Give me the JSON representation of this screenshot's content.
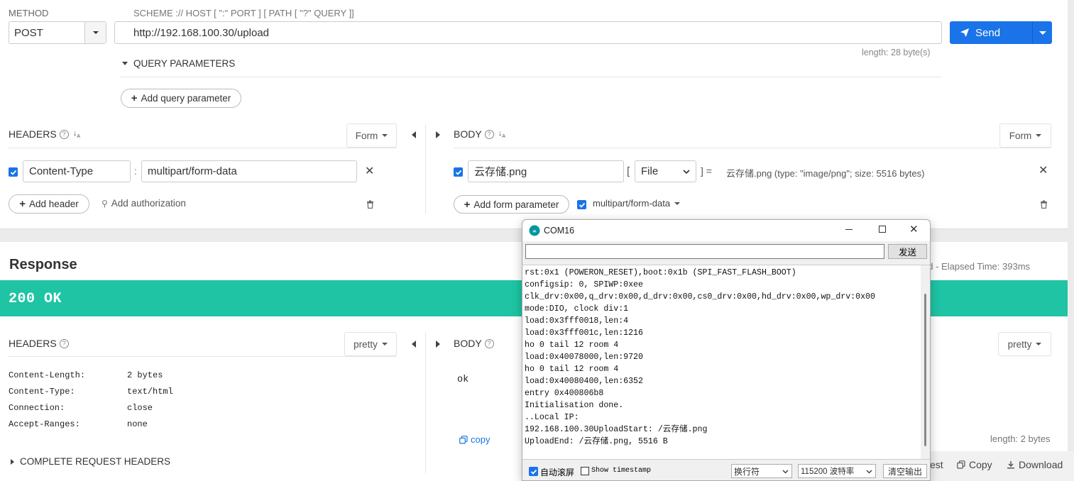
{
  "request": {
    "method_label": "METHOD",
    "method_value": "POST",
    "url_hint": "SCHEME :// HOST [ \":\" PORT ] [ PATH [ \"?\" QUERY ]]",
    "url_value": "http://192.168.100.30/upload",
    "send_label": "Send",
    "length_text": "length: 28 byte(s)",
    "query_params_label": "QUERY PARAMETERS",
    "add_query_param_label": "Add query parameter",
    "headers_label": "HEADERS",
    "headers_mode": "Form",
    "header_name": "Content-Type",
    "header_sep": ":",
    "header_value": "multipart/form-data",
    "add_header_label": "Add header",
    "add_auth_label": "Add authorization",
    "body_label": "BODY",
    "body_mode": "Form",
    "form_name": "云存储.png",
    "form_bracket_open": "[",
    "form_type": "File",
    "form_bracket_close": "] =",
    "form_file_desc": "云存储.png (type: \"image/png\"; size: 5516 bytes)",
    "add_form_param_label": "Add form parameter",
    "multipart_label": "multipart/form-data"
  },
  "response": {
    "title": "Response",
    "elapsed_text": "ed - Elapsed Time: 393ms",
    "status": "200 OK",
    "status_color": "#1ec4a4",
    "headers_label": "HEADERS",
    "headers_mode": "pretty",
    "headers": [
      {
        "name": "Content-Length:",
        "value": "2 bytes"
      },
      {
        "name": "Content-Type:",
        "value": "text/html"
      },
      {
        "name": "Connection:",
        "value": "close"
      },
      {
        "name": "Accept-Ranges:",
        "value": "none"
      }
    ],
    "complete_request_headers_label": "COMPLETE REQUEST HEADERS",
    "body_label": "BODY",
    "body_mode": "pretty",
    "body_text": "ok",
    "copy_label": "copy",
    "length_text": "length: 2 bytes",
    "bottom_partial": "est",
    "bottom_copy_label": "Copy",
    "bottom_download_label": "Download"
  },
  "serial": {
    "title": "COM16",
    "send_label": "发送",
    "lines": [
      "rst:0x1 (POWERON_RESET),boot:0x1b (SPI_FAST_FLASH_BOOT)",
      "configsip: 0, SPIWP:0xee",
      "clk_drv:0x00,q_drv:0x00,d_drv:0x00,cs0_drv:0x00,hd_drv:0x00,wp_drv:0x00",
      "mode:DIO, clock div:1",
      "load:0x3fff0018,len:4",
      "load:0x3fff001c,len:1216",
      "ho 0 tail 12 room 4",
      "load:0x40078000,len:9720",
      "ho 0 tail 12 room 4",
      "load:0x40080400,len:6352",
      "entry 0x400806b8",
      "Initialisation done.",
      "..Local IP:",
      "192.168.100.30UploadStart: /云存储.png",
      "UploadEnd: /云存储.png, 5516 B"
    ],
    "autoscroll_label": "自动滚屏",
    "timestamp_label": "Show timestamp",
    "line_ending": "换行符",
    "baud": "115200 波特率",
    "clear_label": "清空输出"
  },
  "colors": {
    "accent": "#1a73e8",
    "send_button": "#1a73e8",
    "status_green": "#1ec4a4"
  }
}
